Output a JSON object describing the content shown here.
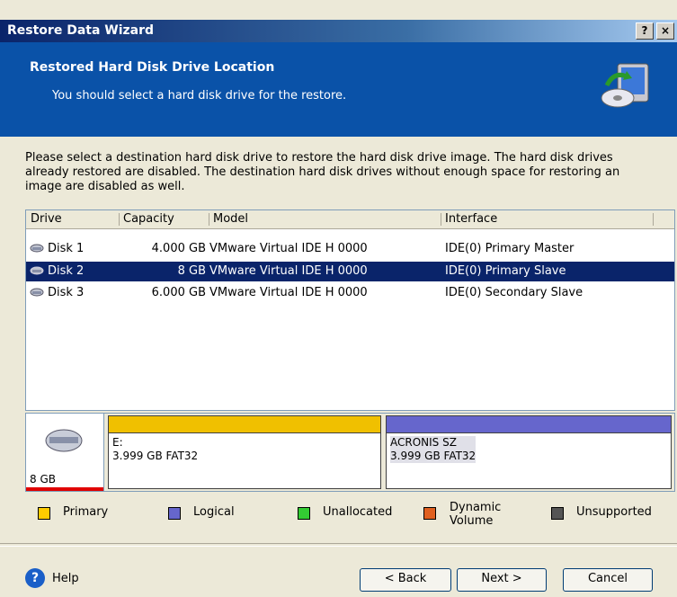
{
  "window": {
    "title": "Restore Data Wizard",
    "help_btn": "?",
    "close_btn": "×"
  },
  "header": {
    "title": "Restored Hard Disk Drive Location",
    "subtitle": "You should select a hard disk drive for the restore."
  },
  "description": "Please select a destination hard disk drive to restore the hard disk drive image. The hard disk drives already restored are disabled. The destination hard disk drives without enough space for restoring an image are disabled as well.",
  "table": {
    "columns": [
      "Drive",
      "Capacity",
      "Model",
      "Interface"
    ],
    "rows": [
      {
        "drive": "Disk 1",
        "capacity": "4.000 GB",
        "model": "VMware Virtual IDE H 0000",
        "interface": "IDE(0) Primary Master"
      },
      {
        "drive": "Disk 2",
        "capacity": "8 GB",
        "model": "VMware Virtual IDE H 0000",
        "interface": "IDE(0) Primary Slave"
      },
      {
        "drive": "Disk 3",
        "capacity": "6.000 GB",
        "model": "VMware Virtual IDE H 0000",
        "interface": "IDE(0) Secondary Slave"
      }
    ],
    "selected_index": 1
  },
  "disk_map": {
    "size": "8 GB",
    "partitions": [
      {
        "label": "E:",
        "info": "3.999 GB  FAT32",
        "color": "#f0c000"
      },
      {
        "label": "ACRONIS SZ",
        "info": "3.999 GB  FAT32",
        "color": "#6666cc"
      }
    ]
  },
  "legend": [
    {
      "label": "Primary",
      "color": "#ffcc00"
    },
    {
      "label": "Logical",
      "color": "#6666cc"
    },
    {
      "label": "Unallocated",
      "color": "#33cc33"
    },
    {
      "label": "Dynamic\nVolume",
      "color": "#e06020"
    },
    {
      "label": "Unsupported",
      "color": "#555555"
    }
  ],
  "buttons": {
    "help": "Help",
    "back": "< Back",
    "next": "Next >",
    "cancel": "Cancel"
  }
}
